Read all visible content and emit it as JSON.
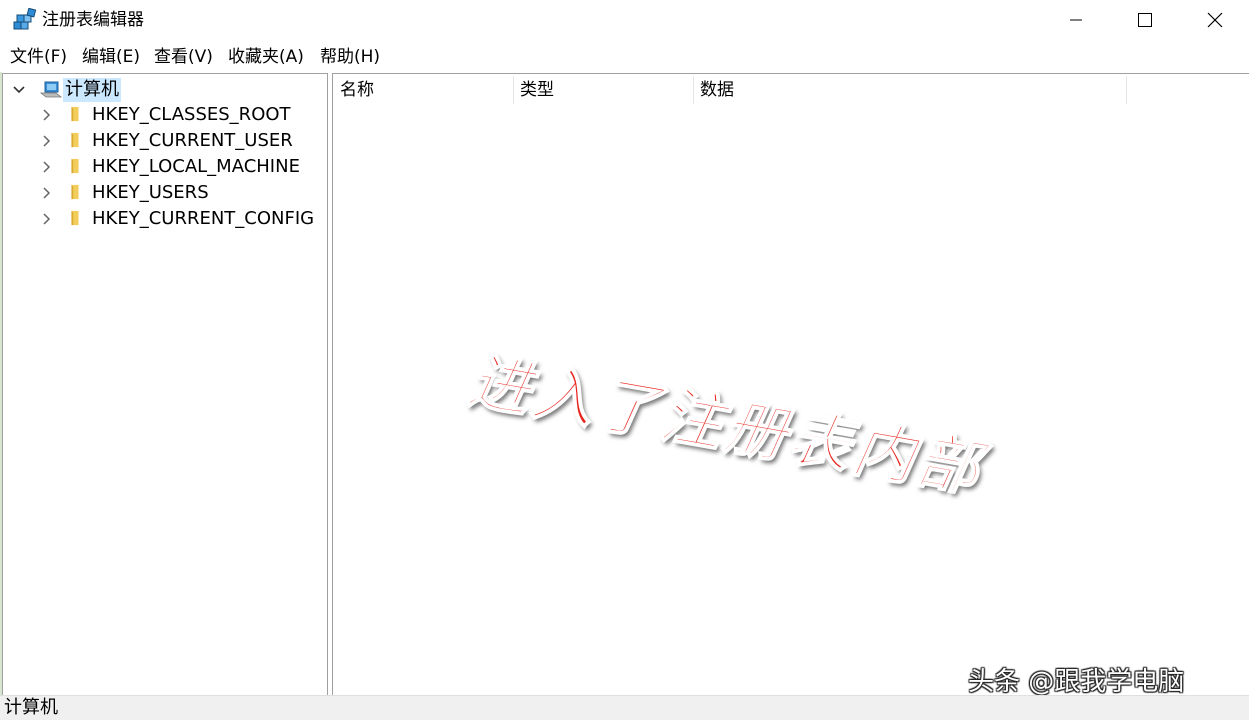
{
  "window": {
    "title": "注册表编辑器",
    "icon": "registry-editor-icon",
    "controls": [
      "minimize-icon",
      "maximize-icon",
      "close-icon"
    ]
  },
  "menubar": {
    "file": "文件(F)",
    "edit": "编辑(E)",
    "view": "查看(V)",
    "favorites": "收藏夹(A)",
    "help": "帮助(H)"
  },
  "tree": {
    "root": {
      "label": "计算机",
      "expanded": true,
      "selected": true,
      "icon": "computer-icon"
    },
    "keys": [
      {
        "label": "HKEY_CLASSES_ROOT",
        "icon": "folder-icon"
      },
      {
        "label": "HKEY_CURRENT_USER",
        "icon": "folder-icon"
      },
      {
        "label": "HKEY_LOCAL_MACHINE",
        "icon": "folder-icon"
      },
      {
        "label": "HKEY_USERS",
        "icon": "folder-icon"
      },
      {
        "label": "HKEY_CURRENT_CONFIG",
        "icon": "folder-icon"
      }
    ]
  },
  "list": {
    "columns": [
      "名称",
      "类型",
      "数据"
    ]
  },
  "statusbar": {
    "path": "计算机"
  },
  "overlay": {
    "caption": "进入了注册表内部",
    "caption_color": "#e8231c",
    "watermark": "头条 @跟我学电脑"
  }
}
